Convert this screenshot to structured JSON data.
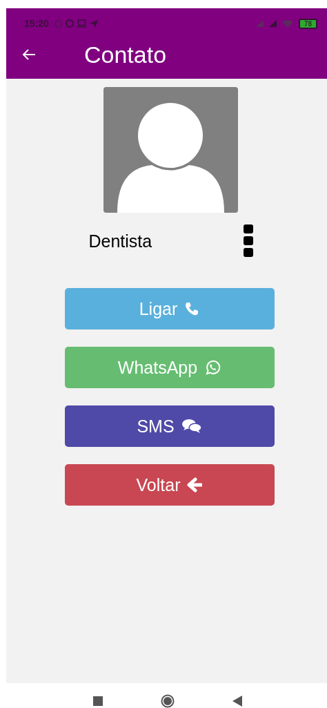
{
  "status_bar": {
    "time": "15:20",
    "battery": "78"
  },
  "app_bar": {
    "title": "Contato"
  },
  "contact": {
    "name": "Dentista"
  },
  "buttons": [
    {
      "label": "Ligar",
      "kind": "phone",
      "color": "#5ab0dc"
    },
    {
      "label": "WhatsApp",
      "kind": "whatsapp",
      "color": "#66bd71"
    },
    {
      "label": "SMS",
      "kind": "chat",
      "color": "#4f4aa8"
    },
    {
      "label": "Voltar",
      "kind": "back",
      "color": "#c84752"
    }
  ]
}
